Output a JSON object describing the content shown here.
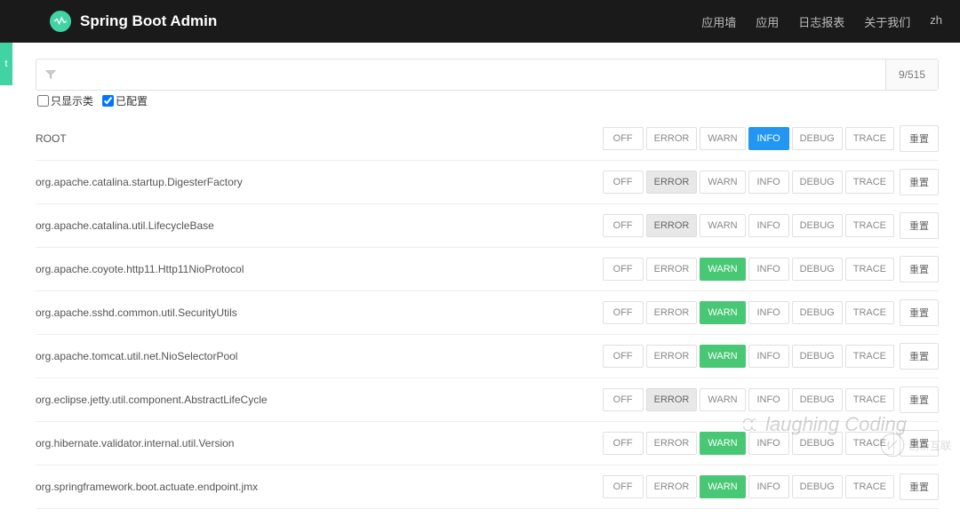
{
  "brand": "Spring Boot Admin",
  "nav": {
    "wallboard": "应用墙",
    "apps": "应用",
    "journal": "日志报表",
    "about": "关于我们",
    "lang": "zh"
  },
  "sideTab": "t",
  "filter": {
    "counter": "9/515"
  },
  "checks": {
    "classOnly": "只显示类",
    "configured": "已配置"
  },
  "levels": {
    "off": "OFF",
    "error": "ERROR",
    "warn": "WARN",
    "info": "INFO",
    "debug": "DEBUG",
    "trace": "TRACE"
  },
  "resetLabel": "重置",
  "loggers": [
    {
      "name": "ROOT",
      "active": "INFO",
      "style": "blue"
    },
    {
      "name": "org.apache.catalina.startup.DigesterFactory",
      "active": "ERROR",
      "style": "grey"
    },
    {
      "name": "org.apache.catalina.util.LifecycleBase",
      "active": "ERROR",
      "style": "grey"
    },
    {
      "name": "org.apache.coyote.http11.Http11NioProtocol",
      "active": "WARN",
      "style": "green"
    },
    {
      "name": "org.apache.sshd.common.util.SecurityUtils",
      "active": "WARN",
      "style": "green"
    },
    {
      "name": "org.apache.tomcat.util.net.NioSelectorPool",
      "active": "WARN",
      "style": "green"
    },
    {
      "name": "org.eclipse.jetty.util.component.AbstractLifeCycle",
      "active": "ERROR",
      "style": "grey"
    },
    {
      "name": "org.hibernate.validator.internal.util.Version",
      "active": "WARN",
      "style": "green"
    },
    {
      "name": "org.springframework.boot.actuate.endpoint.jmx",
      "active": "WARN",
      "style": "green"
    }
  ],
  "watermark": "laughing Coding",
  "watermark2": "创新互联"
}
